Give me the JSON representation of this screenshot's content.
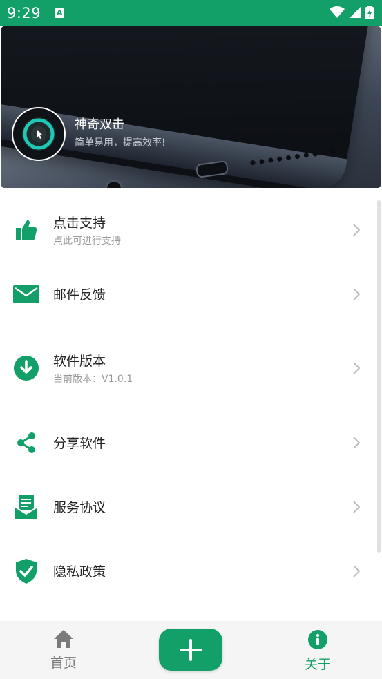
{
  "status_bar": {
    "time": "9:29",
    "notification_icon": "A"
  },
  "header": {
    "app_name": "神奇双击",
    "slogan": "简单易用，提高效率!"
  },
  "menu": [
    {
      "label": "点击支持",
      "sub": "点此可进行支持",
      "icon": "thumbs-up-icon"
    },
    {
      "label": "邮件反馈",
      "sub": "",
      "icon": "mail-icon"
    },
    {
      "label": "软件版本",
      "sub": "当前版本：V1.0.1",
      "icon": "download-icon"
    },
    {
      "label": "分享软件",
      "sub": "",
      "icon": "share-icon"
    },
    {
      "label": "服务协议",
      "sub": "",
      "icon": "agreement-icon"
    },
    {
      "label": "隐私政策",
      "sub": "",
      "icon": "shield-check-icon"
    }
  ],
  "bottom_nav": {
    "home_label": "首页",
    "about_label": "关于",
    "add_label": "+"
  },
  "colors": {
    "accent": "#12a068",
    "inactive": "#7a7a7a"
  }
}
